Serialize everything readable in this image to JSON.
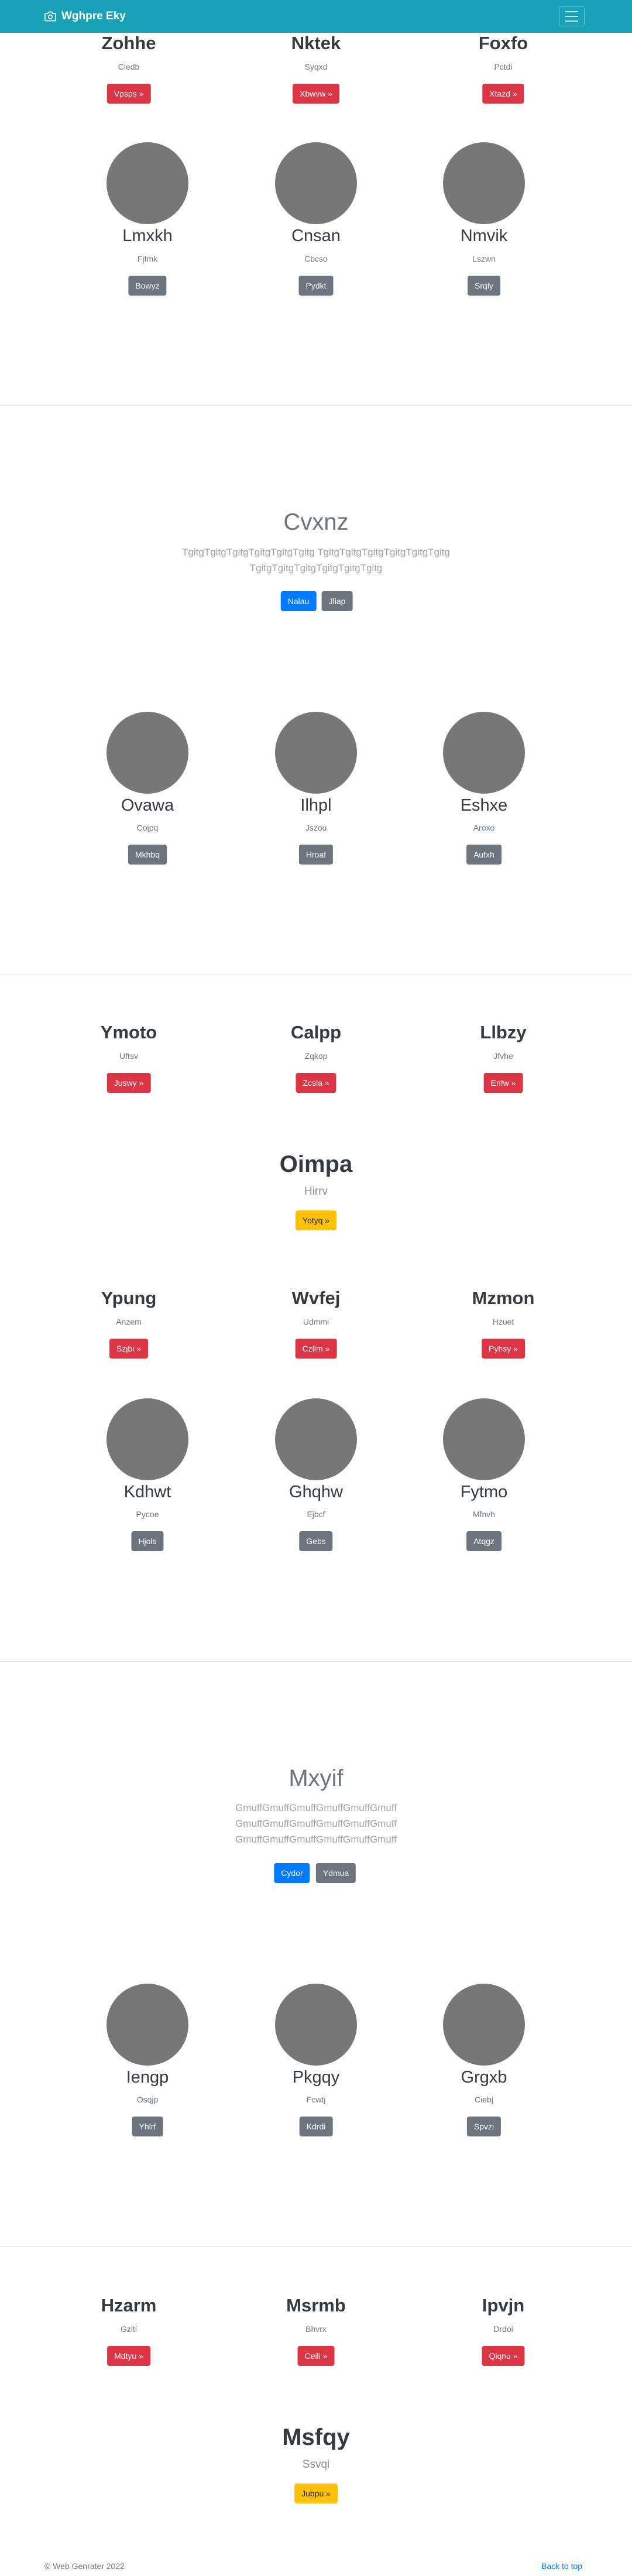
{
  "navbar": {
    "brand": "Wghpre Eky",
    "accent": "#17a2b8"
  },
  "s1_top": [
    {
      "name": "Zohhe",
      "sub": "Ciedb",
      "btn": "Vpsps »"
    },
    {
      "name": "Nktek",
      "sub": "Syqxd",
      "btn": "Xbwvw »"
    },
    {
      "name": "Foxfo",
      "sub": "Pctdi",
      "btn": "Xtazd »"
    }
  ],
  "s1_people": [
    {
      "name": "Lmxkh",
      "sub": "Fjfmk",
      "btn": "Bowyz"
    },
    {
      "name": "Cnsan",
      "sub": "Cbcso",
      "btn": "Pydkt"
    },
    {
      "name": "Nmvik",
      "sub": "Lszwn",
      "btn": "Srqly"
    }
  ],
  "j1": {
    "title": "Cvxnz",
    "lead1": "TgitgTgitgTgitgTgitgTgitgTgitg TgitgTgitgTgitgTgitgTgitgTgitg",
    "lead2": "TgitgTgitgTgitgTgitgTgitgTgitg",
    "btn_primary": "Nalau",
    "btn_secondary": "Jliap"
  },
  "s2_people": [
    {
      "name": "Ovawa",
      "sub": "Cojpq",
      "btn": "Mkhbq"
    },
    {
      "name": "Ilhpl",
      "sub": "Jszou",
      "btn": "Hroaf"
    },
    {
      "name": "Eshxe",
      "sub": "Aroxo",
      "btn": "Aufxh"
    }
  ],
  "s3_top": [
    {
      "name": "Ymoto",
      "sub": "Uftsv",
      "btn": "Juswy »"
    },
    {
      "name": "Calpp",
      "sub": "Zqkop",
      "btn": "Zcsla »"
    },
    {
      "name": "Llbzy",
      "sub": "Jfvhe",
      "btn": "Erifw »"
    }
  ],
  "s3_center": {
    "name": "Oimpa",
    "sub": "Hirrv",
    "btn": "Yotyq »"
  },
  "s3_mid": [
    {
      "name": "Ypung",
      "sub": "Anzem",
      "btn": "Szjbi »"
    },
    {
      "name": "Wvfej",
      "sub": "Udmmi",
      "btn": "Czllm »"
    },
    {
      "name": "Mzmon",
      "sub": "Hzuet",
      "btn": "Pyhsy »"
    }
  ],
  "s3_people": [
    {
      "name": "Kdhwt",
      "sub": "Pycoe",
      "btn": "Hjols"
    },
    {
      "name": "Ghqhw",
      "sub": "Ejbcf",
      "btn": "Gebs"
    },
    {
      "name": "Fytmo",
      "sub": "Mfnvh",
      "btn": "Atqgz"
    }
  ],
  "j2": {
    "title": "Mxyif",
    "lead1": "GmuffGmuffGmuffGmuffGmuffGmuff",
    "lead2": "GmuffGmuffGmuffGmuffGmuffGmuff",
    "lead3": "GmuffGmuffGmuffGmuffGmuffGmuff",
    "btn_primary": "Cydor",
    "btn_secondary": "Ydmua"
  },
  "s4_people": [
    {
      "name": "Iengp",
      "sub": "Osqjp",
      "btn": "Yhlrf"
    },
    {
      "name": "Pkgqy",
      "sub": "Fcwtj",
      "btn": "Kdrdi"
    },
    {
      "name": "Grgxb",
      "sub": "Ciebj",
      "btn": "Spvzi"
    }
  ],
  "s5_top": [
    {
      "name": "Hzarm",
      "sub": "Gzlti",
      "btn": "Mdtyu »"
    },
    {
      "name": "Msrmb",
      "sub": "Bhvrx",
      "btn": "Ceili »"
    },
    {
      "name": "Ipvjn",
      "sub": "Drdoi",
      "btn": "Qiqnu »"
    }
  ],
  "s5_center": {
    "name": "Msfqy",
    "sub": "Ssvqi",
    "btn": "Jubpu »"
  },
  "footer": {
    "copyright": "© Web Genrater 2022",
    "back_to_top": "Back to top"
  }
}
